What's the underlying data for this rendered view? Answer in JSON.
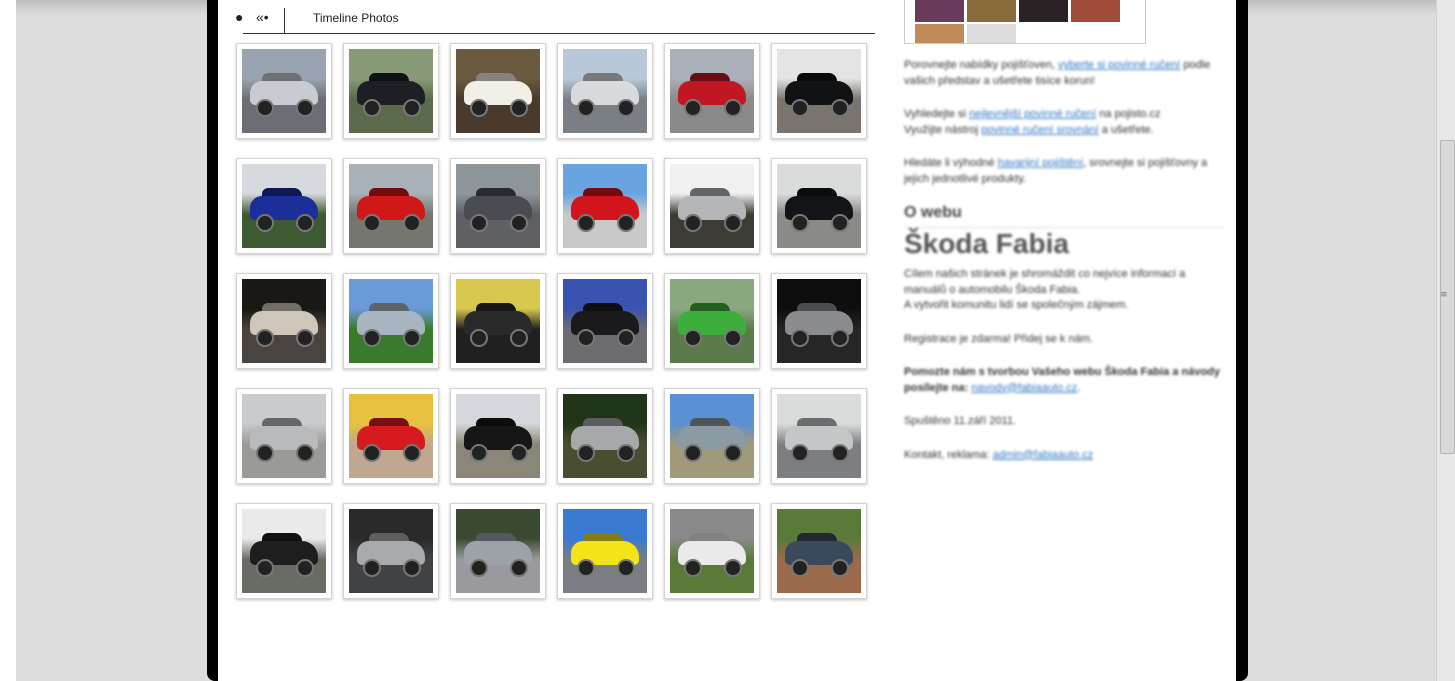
{
  "timeline": {
    "bullet": "●",
    "nav_label": "«•",
    "title": "Timeline Photos"
  },
  "photos": [
    {
      "bg": "#6b6e74",
      "car": "#c8ccd2",
      "sky": "#9aa4b0"
    },
    {
      "bg": "#5a6a4a",
      "car": "#1e1f24",
      "sky": "#889a78"
    },
    {
      "bg": "#4a3a2e",
      "car": "#f2efe6",
      "sky": "#6a5a40"
    },
    {
      "bg": "#7a7f86",
      "car": "#d8dadc",
      "sky": "#b8c8d8"
    },
    {
      "bg": "#8a8a8a",
      "car": "#c01822",
      "sky": "#aab0b8"
    },
    {
      "bg": "#7a756e",
      "car": "#111214",
      "sky": "#e4e4e4"
    },
    {
      "bg": "#3e5a32",
      "car": "#1c2e9a",
      "sky": "#d6dade"
    },
    {
      "bg": "#75766e",
      "car": "#d01818",
      "sky": "#a8b0b8"
    },
    {
      "bg": "#5e6064",
      "car": "#4a4c52",
      "sky": "#8e969a"
    },
    {
      "bg": "#c8c8c8",
      "car": "#d2141c",
      "sky": "#6aa4e0"
    },
    {
      "bg": "#3c3c34",
      "car": "#b4b6b8",
      "sky": "#f0f0f0"
    },
    {
      "bg": "#8a8a86",
      "car": "#121418",
      "sky": "#dadcdc"
    },
    {
      "bg": "#4a4440",
      "car": "#cfc6ba",
      "sky": "#1a1814"
    },
    {
      "bg": "#3a7a2c",
      "car": "#a8b4c0",
      "sky": "#6a9ad8"
    },
    {
      "bg": "#202020",
      "car": "#2a2a2a",
      "sky": "#d8c850"
    },
    {
      "bg": "#6c6c70",
      "car": "#1a1a1c",
      "sky": "#3a52b0"
    },
    {
      "bg": "#5a7a4a",
      "car": "#3cae3c",
      "sky": "#8aa880"
    },
    {
      "bg": "#262626",
      "car": "#8a8c90",
      "sky": "#0e0e0e"
    },
    {
      "bg": "#9a9a96",
      "car": "#b8babc",
      "sky": "#c8ccce"
    },
    {
      "bg": "#c0a890",
      "car": "#d61a20",
      "sky": "#e8c040"
    },
    {
      "bg": "#8a8678",
      "car": "#161616",
      "sky": "#d4d8dc"
    },
    {
      "bg": "#4a4e30",
      "car": "#a6a8aa",
      "sky": "#203418"
    },
    {
      "bg": "#a09a7a",
      "car": "#8c9aa4",
      "sky": "#5a90d4"
    },
    {
      "bg": "#7c7e82",
      "car": "#c4c6c8",
      "sky": "#dadcdc"
    },
    {
      "bg": "#686c64",
      "car": "#1e1e1e",
      "sky": "#eaeaea"
    },
    {
      "bg": "#404244",
      "car": "#a8aaae",
      "sky": "#2a2a2a"
    },
    {
      "bg": "#9a9a9e",
      "car": "#9ca2a8",
      "sky": "#3a4a30"
    },
    {
      "bg": "#7a7e84",
      "car": "#f2e418",
      "sky": "#3a7ad0"
    },
    {
      "bg": "#5a7a3a",
      "car": "#eaeaea",
      "sky": "#8a8a8a"
    },
    {
      "bg": "#9a6a4a",
      "car": "#3a4a5c",
      "sky": "#5a7a3a"
    }
  ],
  "sidebar": {
    "p1_text": "Porovnejte nabídky pojišťoven,",
    "p1_link": "vyberte si povinné ručení",
    "p1_tail": "podle vašich představ a ušetřete tisíce korun!",
    "p2_text": "Vyhledejte si",
    "p2_link": "nejlevnější povinné ručení",
    "p2_mid": "na pojisto.cz",
    "p2_text2": "Využijte nástroj",
    "p2_link2": "povinné ručení srovnání",
    "p2_tail": "a ušetřete.",
    "p3_text": "Hledáte li výhodné",
    "p3_link": "havarijní pojištění",
    "p3_tail": ", srovnejte si pojišťovny a jejich jednotlivé produkty.",
    "about_heading": "O webu",
    "site_title": "Škoda Fabia",
    "p4": "Cílem našich stránek je shromáždit co nejvíce informací a manuálů o automobilu Škoda Fabia.",
    "p4b": "A vytvořit komunitu lidí se společným zájmem.",
    "p5": "Registrace je zdarma! Přidej se k nám.",
    "p6": "Pomozte nám s tvorbou Vašeho webu Škoda Fabia a návody posílejte na:",
    "p6_link": "navody@fabiaauto.cz",
    "p7": "Spuštěno 11.září 2011.",
    "p8_text": "Kontakt, reklama:",
    "p8_link": "admin@fabiaauto.cz"
  }
}
